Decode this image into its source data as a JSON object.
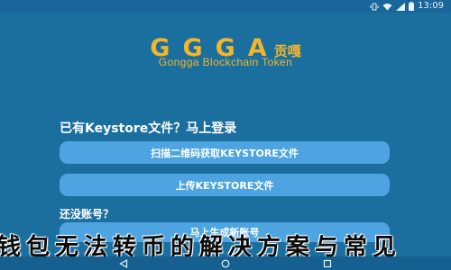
{
  "status_bar": {
    "time": "13:09",
    "icons": [
      "vibrate-icon",
      "wifi-icon",
      "signal-icon",
      "battery-icon"
    ]
  },
  "logo": {
    "text": "GGGA",
    "cn": "贡嘎",
    "subtitle": "Gongga Blockchain Token"
  },
  "keystore": {
    "title": "已有Keystore文件？马上登录",
    "scan_button": "扫描二维码获取KEYSTORE文件",
    "upload_button": "上传KEYSTORE文件"
  },
  "register": {
    "title": "还没账号？",
    "button": "马上生成新账号"
  },
  "overlay": {
    "headline": "钱包无法转币的解决方案与常见"
  },
  "nav": {
    "icons": [
      "back-icon",
      "home-icon",
      "recent-apps-icon"
    ]
  },
  "colors": {
    "background": "#1b6f9f",
    "accent_gold": "#f3b62a",
    "button": "#4da4e0"
  }
}
